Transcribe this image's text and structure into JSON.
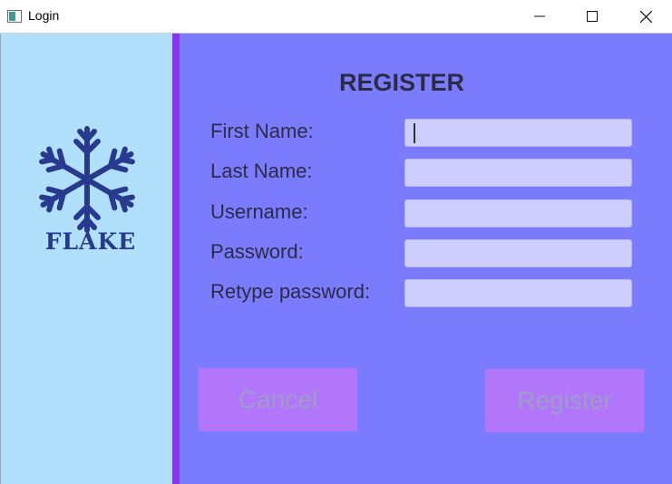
{
  "window": {
    "title": "Login",
    "controls": [
      "minimize-icon",
      "maximize-icon",
      "close-icon"
    ]
  },
  "sidebar": {
    "logo_icon": "snowflake-icon",
    "brand": "FLAKE"
  },
  "form": {
    "title": "REGISTER",
    "fields": [
      {
        "label": "First Name:",
        "value": ""
      },
      {
        "label": "Last Name:",
        "value": ""
      },
      {
        "label": "Username:",
        "value": ""
      },
      {
        "label": "Password:",
        "value": ""
      },
      {
        "label": "Retype password:",
        "value": ""
      }
    ],
    "buttons": {
      "cancel": "Cancel",
      "register": "Register"
    }
  },
  "colors": {
    "sidebar_bg": "#b0e0fb",
    "divider": "#8a33f0",
    "main_bg": "#7b7bfd",
    "input_bg": "#cdcdfe",
    "button_bg": "#b276fb",
    "logo": "#283a8e"
  }
}
